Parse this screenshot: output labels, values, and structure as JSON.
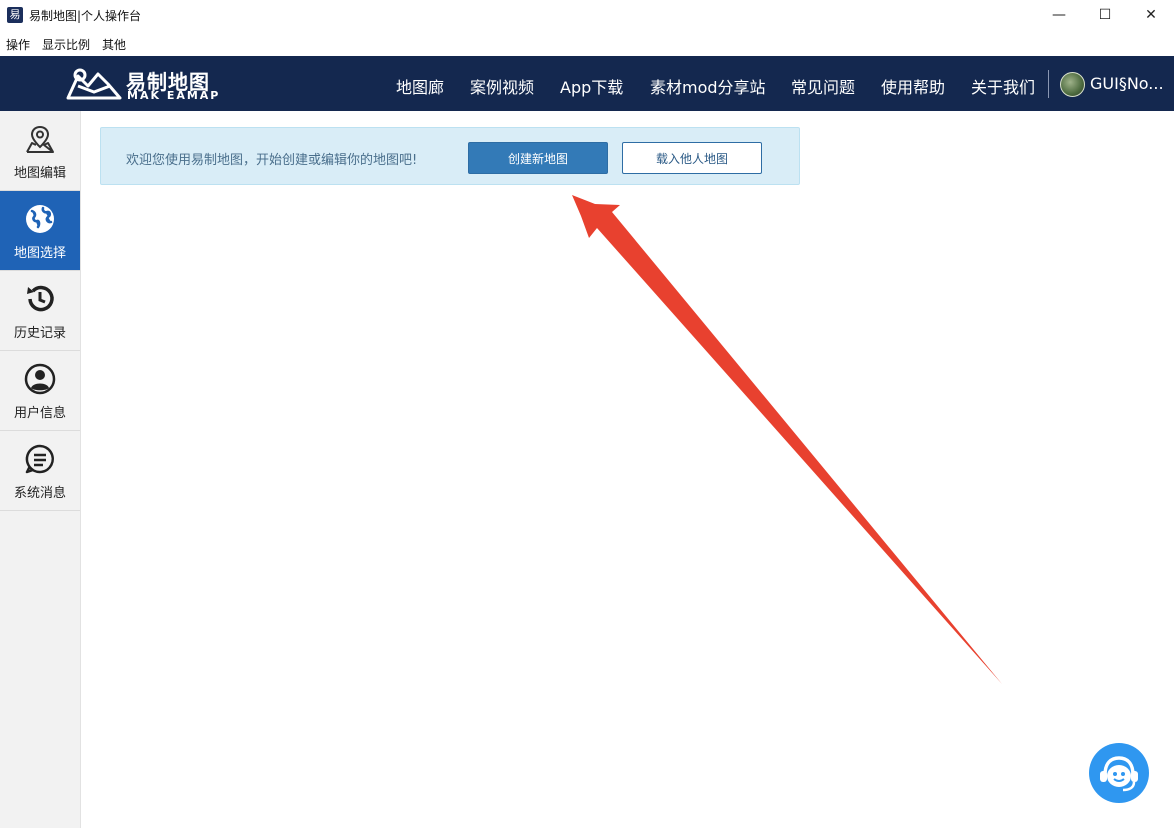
{
  "window": {
    "icon_char": "易",
    "title": "易制地图|个人操作台",
    "minimize": "—",
    "maximize": "☐",
    "close": "✕"
  },
  "menubar": {
    "items": [
      "操作",
      "显示比例",
      "其他"
    ]
  },
  "header": {
    "logo_cn": "易制地图",
    "logo_en": "MAK EAMAP",
    "nav": [
      "地图廊",
      "案例视频",
      "App下载",
      "素材mod分享站",
      "常见问题",
      "使用帮助",
      "关于我们"
    ],
    "username": "GUI§No..."
  },
  "sidebar": {
    "items": [
      {
        "label": "地图编辑",
        "icon": "map-pin-icon",
        "active": false
      },
      {
        "label": "地图选择",
        "icon": "globe-icon",
        "active": true
      },
      {
        "label": "历史记录",
        "icon": "history-icon",
        "active": false
      },
      {
        "label": "用户信息",
        "icon": "user-icon",
        "active": false
      },
      {
        "label": "系统消息",
        "icon": "message-icon",
        "active": false
      }
    ]
  },
  "banner": {
    "text": "欢迎您使用易制地图，开始创建或编辑你的地图吧!",
    "create_label": "创建新地图",
    "load_label": "载入他人地图"
  },
  "colors": {
    "header_bg": "#14284f",
    "sidebar_active": "#1f63b6",
    "primary_button": "#337ab7",
    "banner_bg": "#d9edf7",
    "arrow": "#e8412f",
    "support_button": "#2f97f0"
  }
}
